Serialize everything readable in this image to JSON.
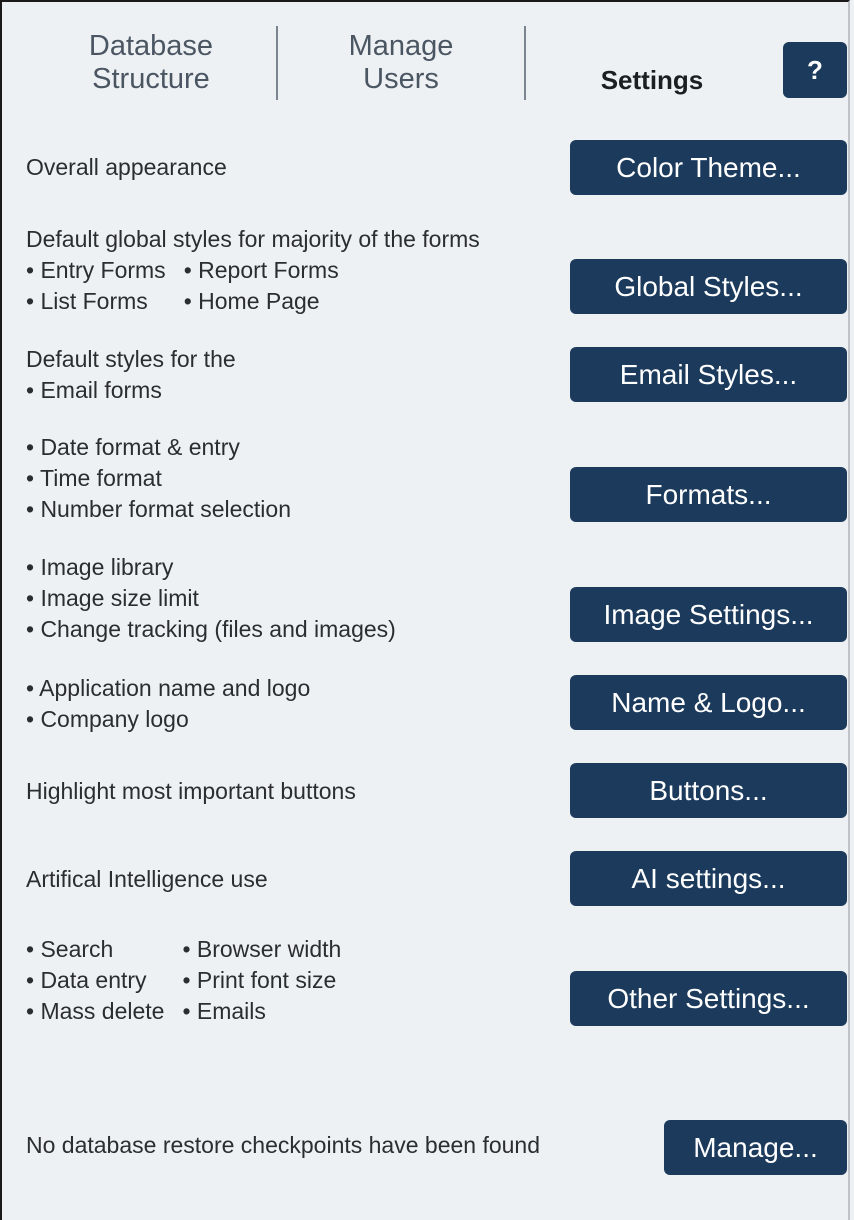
{
  "tabs": {
    "database_structure": [
      "Database",
      "Structure"
    ],
    "manage_users": [
      "Manage",
      "Users"
    ],
    "settings": "Settings"
  },
  "help_label": "?",
  "sections": {
    "color_theme": {
      "lines": [
        "Overall appearance"
      ],
      "button": "Color Theme..."
    },
    "global_styles": {
      "lines": [
        "Default global styles for majority of the forms"
      ],
      "col1": [
        "• Entry Forms",
        "• List Forms"
      ],
      "col2": [
        "• Report Forms",
        "• Home Page"
      ],
      "button": "Global Styles..."
    },
    "email_styles": {
      "lines": [
        "Default styles for the",
        "• Email forms"
      ],
      "button": "Email Styles..."
    },
    "formats": {
      "lines": [
        "• Date format & entry",
        "• Time format",
        "• Number format selection"
      ],
      "button": "Formats..."
    },
    "image_settings": {
      "lines": [
        "• Image library",
        "• Image size limit",
        "• Change tracking (files and images)"
      ],
      "button": "Image Settings..."
    },
    "name_logo": {
      "lines": [
        "• Application name and logo",
        "• Company logo"
      ],
      "button": "Name & Logo..."
    },
    "buttons": {
      "lines": [
        "Highlight most important buttons"
      ],
      "button": "Buttons..."
    },
    "ai_settings": {
      "lines": [
        "Artifical Intelligence use"
      ],
      "button": "AI settings..."
    },
    "other_settings": {
      "col1": [
        "• Search",
        "• Data entry",
        "• Mass delete"
      ],
      "col2": [
        "• Browser width",
        "• Print font size",
        "• Emails"
      ],
      "button": "Other Settings..."
    },
    "restore": {
      "lines": [
        "No database restore checkpoints have been found"
      ],
      "button": "Manage..."
    }
  }
}
